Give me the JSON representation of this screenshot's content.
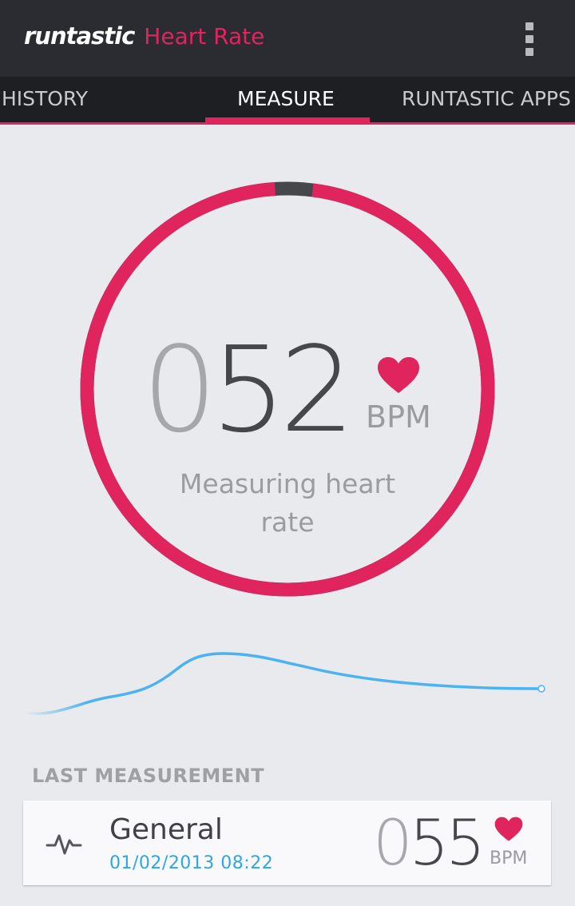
{
  "app": {
    "brand": "runtastic",
    "product": "Heart Rate"
  },
  "tabs": [
    {
      "label": "HISTORY",
      "active": false
    },
    {
      "label": "MEASURE",
      "active": true
    },
    {
      "label": "RUNTASTIC APPS",
      "active": false
    }
  ],
  "measure": {
    "digits_dim": "0",
    "digits_main": "52",
    "unit": "BPM",
    "status": "Measuring heart rate",
    "progress": 0.97
  },
  "last_measurement": {
    "section_title": "LAST MEASUREMENT",
    "name": "General",
    "datetime": "01/02/2013 08:22",
    "digits_dim": "0",
    "digits_main": "55",
    "unit": "BPM"
  },
  "icons": {
    "heart": "heart-icon",
    "pulse": "pulse-icon",
    "menu": "overflow-menu-icon"
  },
  "colors": {
    "accent": "#e0245e",
    "topbar": "#2b2c31",
    "tabbar": "#1e1f23",
    "background": "#e8eaee",
    "graph_line": "#4ab3f0",
    "date_text": "#2ea6e6"
  }
}
